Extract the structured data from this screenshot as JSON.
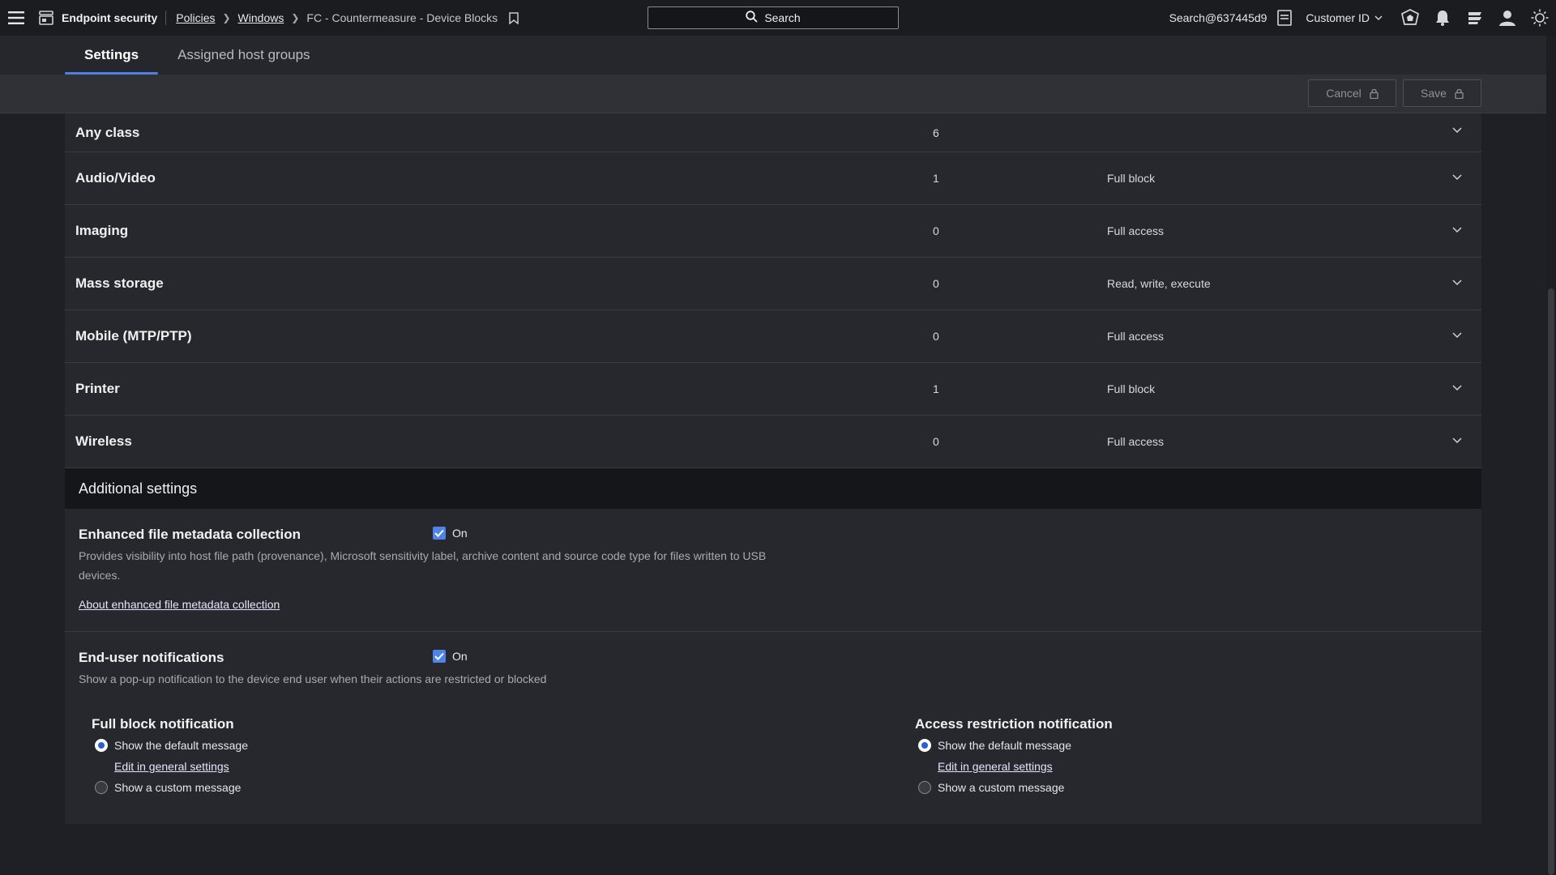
{
  "header": {
    "app_name": "Endpoint security",
    "breadcrumbs": [
      "Policies",
      "Windows"
    ],
    "current_page": "FC - Countermeasure - Device Blocks",
    "search_label": "Search",
    "user_id": "Search@637445d9",
    "customer_label": "Customer ID",
    "icons": [
      "menu-icon",
      "endpoint-app-icon",
      "bookmark-icon",
      "search-icon",
      "statement-icon",
      "chevron-down-icon",
      "badge-icon",
      "bell-icon",
      "updates-icon",
      "user-icon",
      "theme-sun-icon"
    ]
  },
  "tabs": [
    {
      "label": "Settings",
      "active": true
    },
    {
      "label": "Assigned host groups",
      "active": false
    }
  ],
  "actions": {
    "cancel_label": "Cancel",
    "save_label": "Save"
  },
  "device_classes": [
    {
      "name": "Any class",
      "count": "6",
      "access": ""
    },
    {
      "name": "Audio/Video",
      "count": "1",
      "access": "Full block"
    },
    {
      "name": "Imaging",
      "count": "0",
      "access": "Full access"
    },
    {
      "name": "Mass storage",
      "count": "0",
      "access": "Read, write, execute"
    },
    {
      "name": "Mobile (MTP/PTP)",
      "count": "0",
      "access": "Full access"
    },
    {
      "name": "Printer",
      "count": "1",
      "access": "Full block"
    },
    {
      "name": "Wireless",
      "count": "0",
      "access": "Full access"
    }
  ],
  "additional": {
    "header": "Additional settings",
    "metadata": {
      "title": "Enhanced file metadata collection",
      "state": "On",
      "checked": true,
      "description": "Provides visibility into host file path (provenance), Microsoft sensitivity label, archive content and source code type for files written to USB devices.",
      "link": "About enhanced file metadata collection"
    },
    "notifications": {
      "title": "End-user notifications",
      "state": "On",
      "checked": true,
      "description": "Show a pop-up notification to the device end user when their actions are restricted or blocked",
      "full_block": {
        "title": "Full block notification",
        "option_default": "Show the default message",
        "edit_link": "Edit in general settings",
        "option_custom": "Show a custom message",
        "selected": "default"
      },
      "access_restriction": {
        "title": "Access restriction notification",
        "option_default": "Show the default message",
        "edit_link": "Edit in general settings",
        "option_custom": "Show a custom message",
        "selected": "default"
      }
    }
  },
  "colors": {
    "accent": "#4f84e6",
    "background": "#1f2025",
    "panel": "#27282d"
  }
}
